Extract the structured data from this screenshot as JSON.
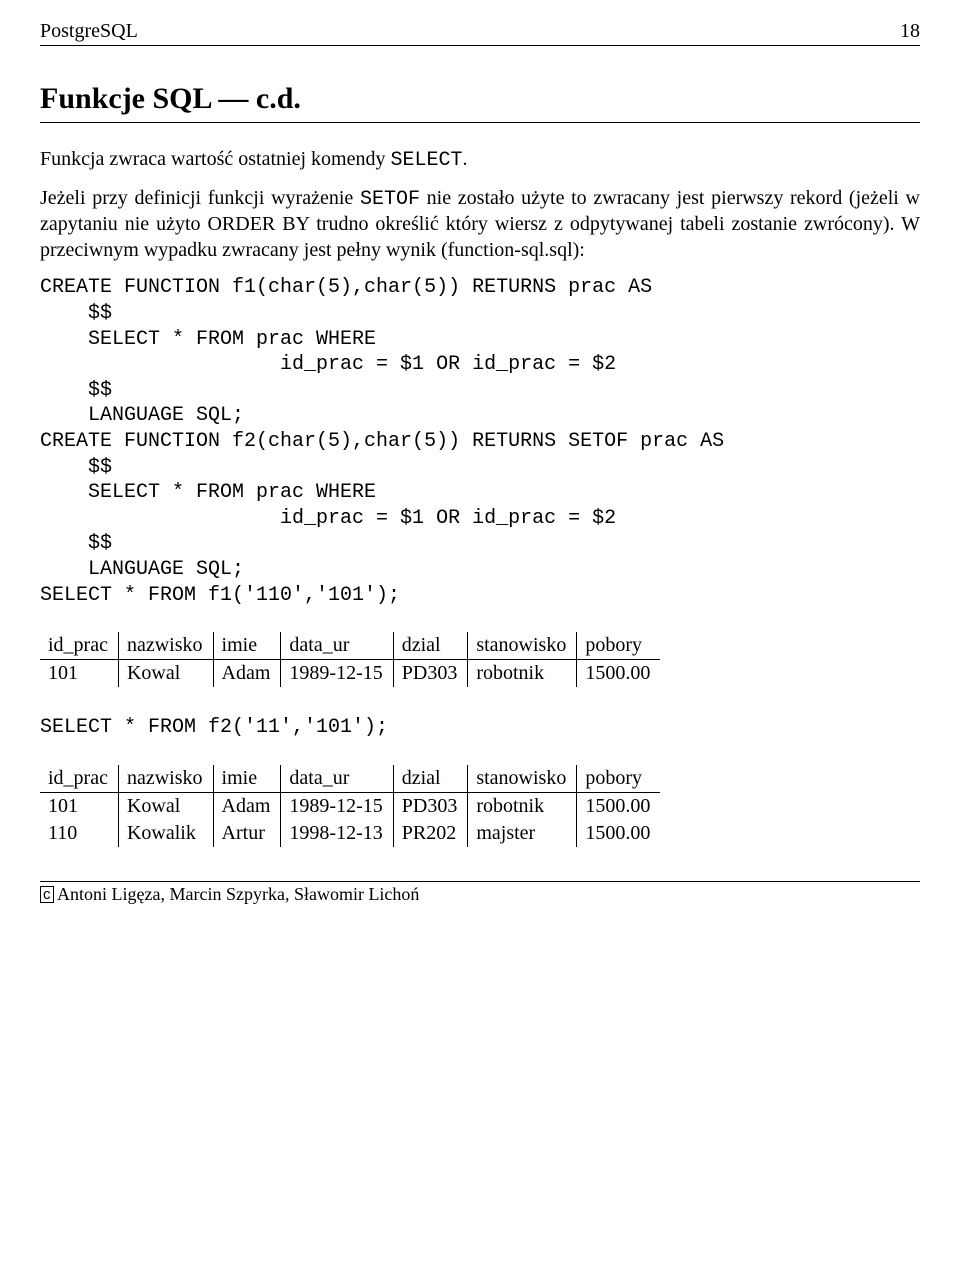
{
  "header": {
    "left": "PostgreSQL",
    "right": "18"
  },
  "title": "Funkcje SQL — c.d.",
  "para1_pre": "Funkcja zwraca wartość ostatniej komendy ",
  "para1_code": "SELECT",
  "para1_post": ".",
  "para2_pre": "Jeżeli przy definicji funkcji wyrażenie ",
  "para2_code": "SETOF",
  "para2_post": " nie zostało użyte to zwracany jest pierwszy rekord (jeżeli w zapytaniu nie użyto ORDER BY trudno określić który wiersz z odpytywanej tabeli zostanie zwrócony). W przeciwnym wypadku zwracany jest pełny wynik (function-sql.sql):",
  "code1": "CREATE FUNCTION f1(char(5),char(5)) RETURNS prac AS\n    $$\n    SELECT * FROM prac WHERE\n                    id_prac = $1 OR id_prac = $2\n    $$\n    LANGUAGE SQL;\nCREATE FUNCTION f2(char(5),char(5)) RETURNS SETOF prac AS\n    $$\n    SELECT * FROM prac WHERE\n                    id_prac = $1 OR id_prac = $2\n    $$\n    LANGUAGE SQL;\nSELECT * FROM f1('110','101');",
  "table1": {
    "headers": [
      "id_prac",
      "nazwisko",
      "imie",
      "data_ur",
      "dzial",
      "stanowisko",
      "pobory"
    ],
    "rows": [
      [
        "101",
        "Kowal",
        "Adam",
        "1989-12-15",
        "PD303",
        "robotnik",
        "1500.00"
      ]
    ]
  },
  "code2": "SELECT * FROM f2('11','101');",
  "table2": {
    "headers": [
      "id_prac",
      "nazwisko",
      "imie",
      "data_ur",
      "dzial",
      "stanowisko",
      "pobory"
    ],
    "rows": [
      [
        "101",
        "Kowal",
        "Adam",
        "1989-12-15",
        "PD303",
        "robotnik",
        "1500.00"
      ],
      [
        "110",
        "Kowalik",
        "Artur",
        "1998-12-13",
        "PR202",
        "majster",
        "1500.00"
      ]
    ]
  },
  "footer": {
    "copyright_symbol": "c",
    "authors": "Antoni Ligęza, Marcin Szpyrka, Sławomir Lichoń"
  }
}
